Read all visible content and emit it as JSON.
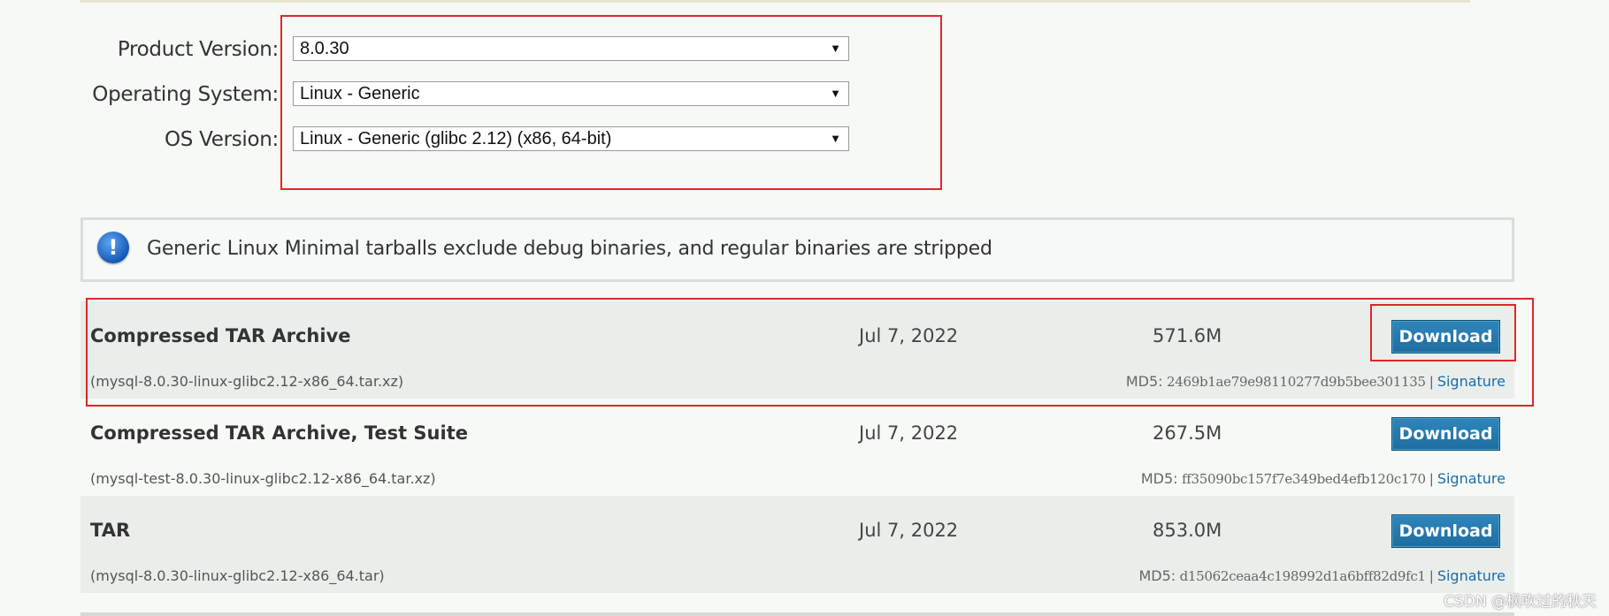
{
  "filters": {
    "product_version": {
      "label": "Product Version:",
      "value": "8.0.30"
    },
    "operating_system": {
      "label": "Operating System:",
      "value": "Linux - Generic"
    },
    "os_version": {
      "label": "OS Version:",
      "value": "Linux - Generic (glibc 2.12) (x86, 64-bit)"
    },
    "dropdown_arrow": "▼"
  },
  "notice": {
    "icon": "info-exclamation-icon",
    "icon_glyph": "!",
    "text": "Generic Linux Minimal tarballs exclude debug binaries, and regular binaries are stripped"
  },
  "downloads": [
    {
      "name": "Compressed TAR Archive",
      "file": "(mysql-8.0.30-linux-glibc2.12-x86_64.tar.xz)",
      "date": "Jul 7, 2022",
      "size": "571.6M",
      "md5_label": "MD5:",
      "md5": "2469b1ae79e98110277d9b5bee301135",
      "separator": "|",
      "signature": "Signature",
      "button": "Download"
    },
    {
      "name": "Compressed TAR Archive, Test Suite",
      "file": "(mysql-test-8.0.30-linux-glibc2.12-x86_64.tar.xz)",
      "date": "Jul 7, 2022",
      "size": "267.5M",
      "md5_label": "MD5:",
      "md5": "ff35090bc157f7e349bed4efb120c170",
      "separator": "|",
      "signature": "Signature",
      "button": "Download"
    },
    {
      "name": "TAR",
      "file": "(mysql-8.0.30-linux-glibc2.12-x86_64.tar)",
      "date": "Jul 7, 2022",
      "size": "853.0M",
      "md5_label": "MD5:",
      "md5": "d15062ceaa4c198992d1a6bff82d9fc1",
      "separator": "|",
      "signature": "Signature",
      "button": "Download"
    }
  ],
  "watermark": "CSDN @枫吹过的秋天",
  "colors": {
    "highlight": "#e0262b",
    "button": "#1e6d9f",
    "link": "#1a6ca8",
    "row_shade": "#eaeeeb"
  }
}
